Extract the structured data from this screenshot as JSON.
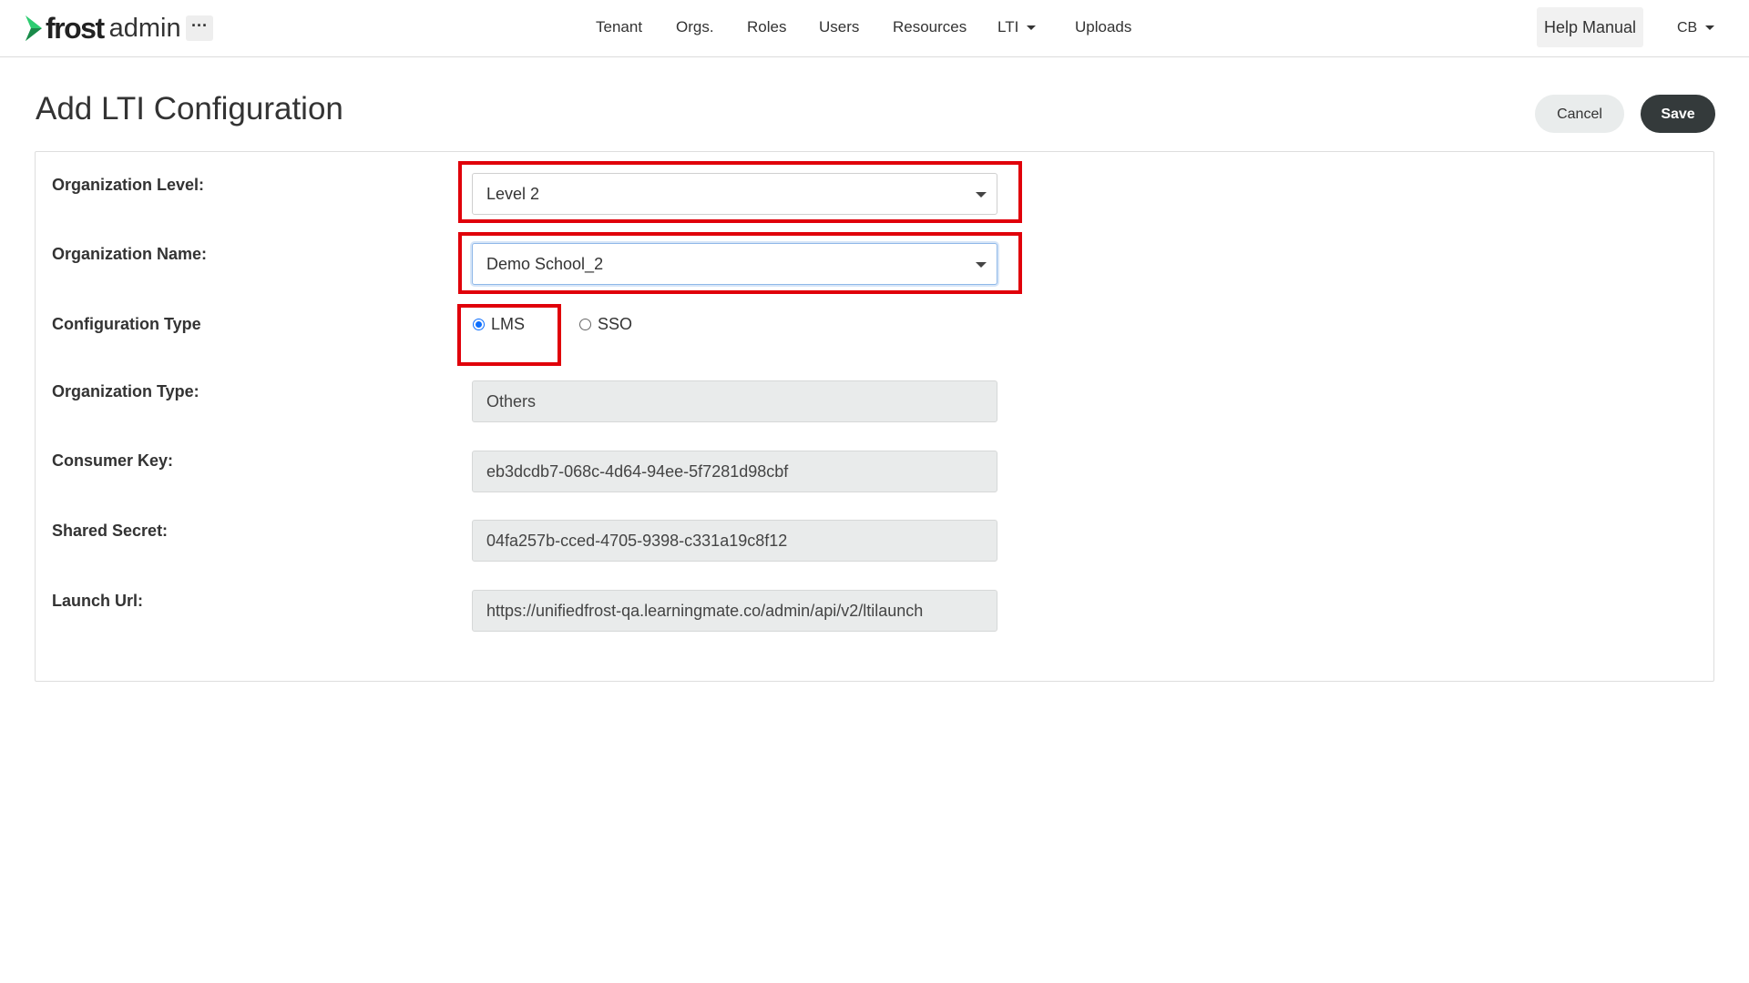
{
  "topnav": {
    "brand_frost": "frost",
    "brand_admin": "admin",
    "more_label": "···",
    "items": [
      {
        "label": "Tenant"
      },
      {
        "label": "Orgs."
      },
      {
        "label": "Roles"
      },
      {
        "label": "Users"
      },
      {
        "label": "Resources"
      },
      {
        "label": "LTI"
      },
      {
        "label": "Uploads"
      }
    ],
    "help_label": "Help Manual",
    "user_initials": "CB"
  },
  "page": {
    "title": "Add LTI Configuration",
    "cancel_label": "Cancel",
    "save_label": "Save"
  },
  "form": {
    "org_level": {
      "label": "Organization Level:",
      "value": "Level 2"
    },
    "org_name": {
      "label": "Organization Name:",
      "value": "Demo School_2"
    },
    "config_type": {
      "label": "Configuration Type",
      "options": [
        {
          "label": "LMS",
          "checked": true
        },
        {
          "label": "SSO",
          "checked": false
        }
      ]
    },
    "org_type": {
      "label": "Organization Type:",
      "value": "Others"
    },
    "consumer_key": {
      "label": "Consumer Key:",
      "value": "eb3dcdb7-068c-4d64-94ee-5f7281d98cbf"
    },
    "shared_secret": {
      "label": "Shared Secret:",
      "value": "04fa257b-cced-4705-9398-c331a19c8f12"
    },
    "launch_url": {
      "label": "Launch Url:",
      "value": "https://unifiedfrost-qa.learningmate.co/admin/api/v2/ltilaunch"
    }
  },
  "colors": {
    "highlight": "#e0000a",
    "brand_green": "#2ecc71",
    "save_bg": "#343a3b",
    "radio_checked": "#0d6efd"
  }
}
